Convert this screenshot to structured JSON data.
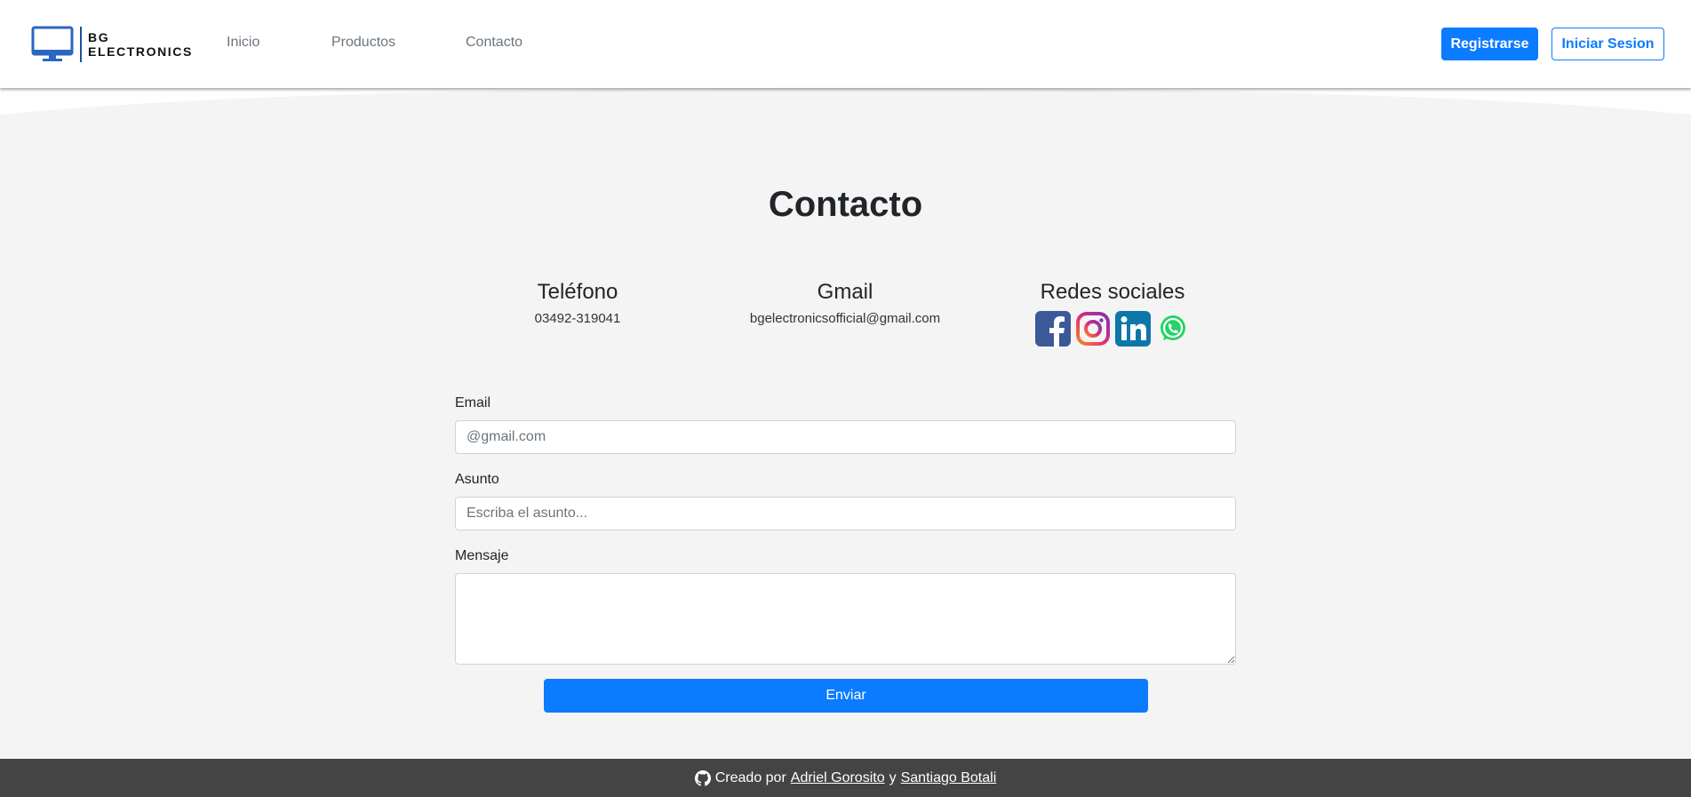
{
  "header": {
    "brand": {
      "line1": "BG",
      "line2": "ELECTRONICS"
    },
    "nav": [
      {
        "label": "Inicio"
      },
      {
        "label": "Productos"
      },
      {
        "label": "Contacto"
      }
    ],
    "register_label": "Registrarse",
    "login_label": "Iniciar Sesion"
  },
  "main": {
    "title": "Contacto",
    "info": {
      "phone": {
        "heading": "Teléfono",
        "value": "03492-319041"
      },
      "gmail": {
        "heading": "Gmail",
        "value": "bgelectronicsofficial@gmail.com"
      },
      "social": {
        "heading": "Redes sociales",
        "icons": [
          "facebook-icon",
          "instagram-icon",
          "linkedin-icon",
          "whatsapp-icon"
        ]
      }
    },
    "form": {
      "email": {
        "label": "Email",
        "placeholder": "@gmail.com",
        "value": ""
      },
      "subject": {
        "label": "Asunto",
        "placeholder": "Escriba el asunto...",
        "value": ""
      },
      "message": {
        "label": "Mensaje",
        "placeholder": "",
        "value": ""
      },
      "submit_label": "Enviar"
    }
  },
  "footer": {
    "prefix": "Creado por",
    "author1": "Adriel Gorosito",
    "joiner": "y",
    "author2": "Santiago Botali"
  },
  "colors": {
    "primary": "#0b7bff",
    "background": "#f4f4f4",
    "footer": "#444444",
    "facebook": "#3b5998",
    "linkedin": "#0e76a8",
    "whatsapp": "#25d366"
  }
}
